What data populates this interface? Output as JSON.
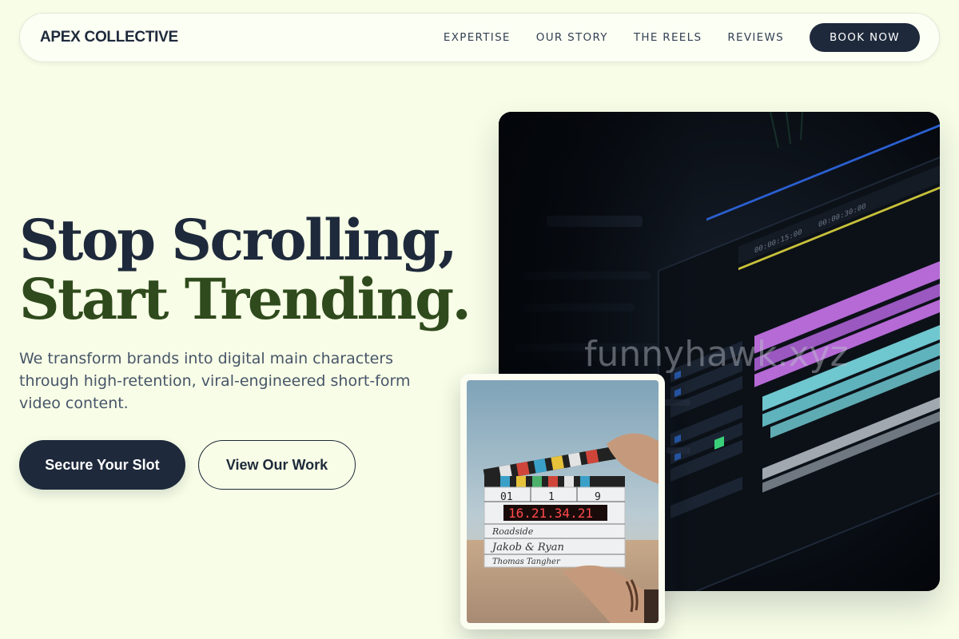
{
  "header": {
    "brand": "APEX COLLECTIVE",
    "nav": [
      "EXPERTISE",
      "OUR STORY",
      "THE REELS",
      "REVIEWS"
    ],
    "book_label": "BOOK NOW"
  },
  "hero": {
    "headline_line1": "Stop Scrolling,",
    "headline_line2": "Start Trending.",
    "subtext": "We transform brands into digital main characters through high-retention, viral-engineered short-form video content.",
    "cta_primary": "Secure Your Slot",
    "cta_secondary": "View Our Work"
  },
  "images": {
    "editor_alt": "Video editing timeline on a monitor",
    "clapper": {
      "counter": "16.21.34.21",
      "roll": "01",
      "scene": "1",
      "take": "9",
      "production": "Roadside",
      "director": "Jakob & Ryan",
      "camera": "Thomas Tangher"
    }
  },
  "watermark": "funnyhawk.xyz",
  "colors": {
    "background": "#f7fde6",
    "navy": "#1e293b",
    "olive": "#2f4a1c",
    "clip_purple": "#b56ad6",
    "clip_teal": "#6fc7cf"
  }
}
